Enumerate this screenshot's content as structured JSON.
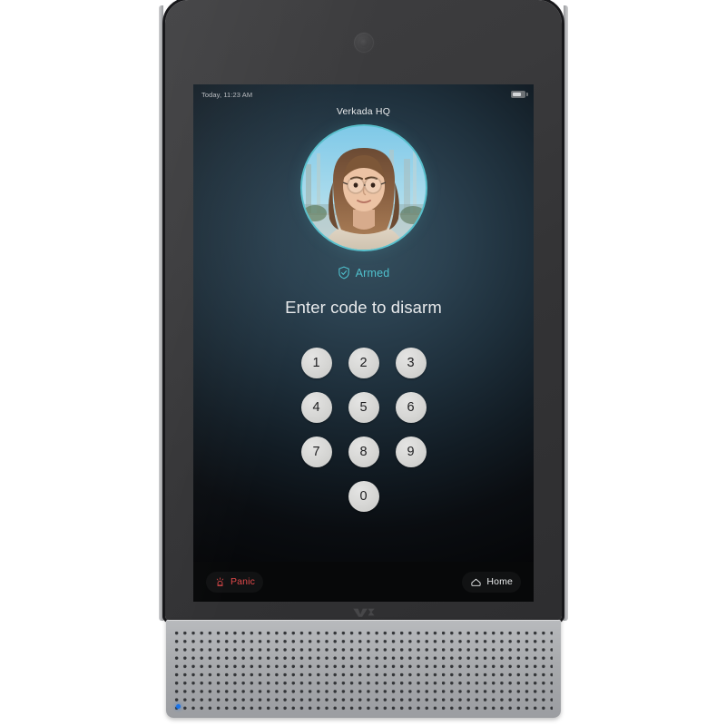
{
  "device": {
    "name": "verkada-intercom-panel",
    "camera_icon": "camera-lens-icon",
    "logo_icon": "verkada-logo",
    "led_icon": "status-led-indicator",
    "led_color": "#1a73e8"
  },
  "screen": {
    "statusbar": {
      "time": "Today, 11:23 AM",
      "battery_icon": "battery-icon"
    },
    "site_title": "Verkada HQ",
    "avatar": {
      "icon": "user-avatar",
      "ring_color": "#58c0cc"
    },
    "status": {
      "icon": "shield-check-icon",
      "label": "Armed",
      "color": "#4fc0cd"
    },
    "prompt": "Enter code to disarm",
    "keypad": {
      "keys": [
        "1",
        "2",
        "3",
        "4",
        "5",
        "6",
        "7",
        "8",
        "9"
      ],
      "zero": "0"
    },
    "actions": {
      "panic": {
        "label": "Panic",
        "icon": "alarm-siren-icon",
        "color": "#e0494a"
      },
      "home": {
        "label": "Home",
        "icon": "house-icon",
        "color": "#e9ebec"
      }
    }
  }
}
